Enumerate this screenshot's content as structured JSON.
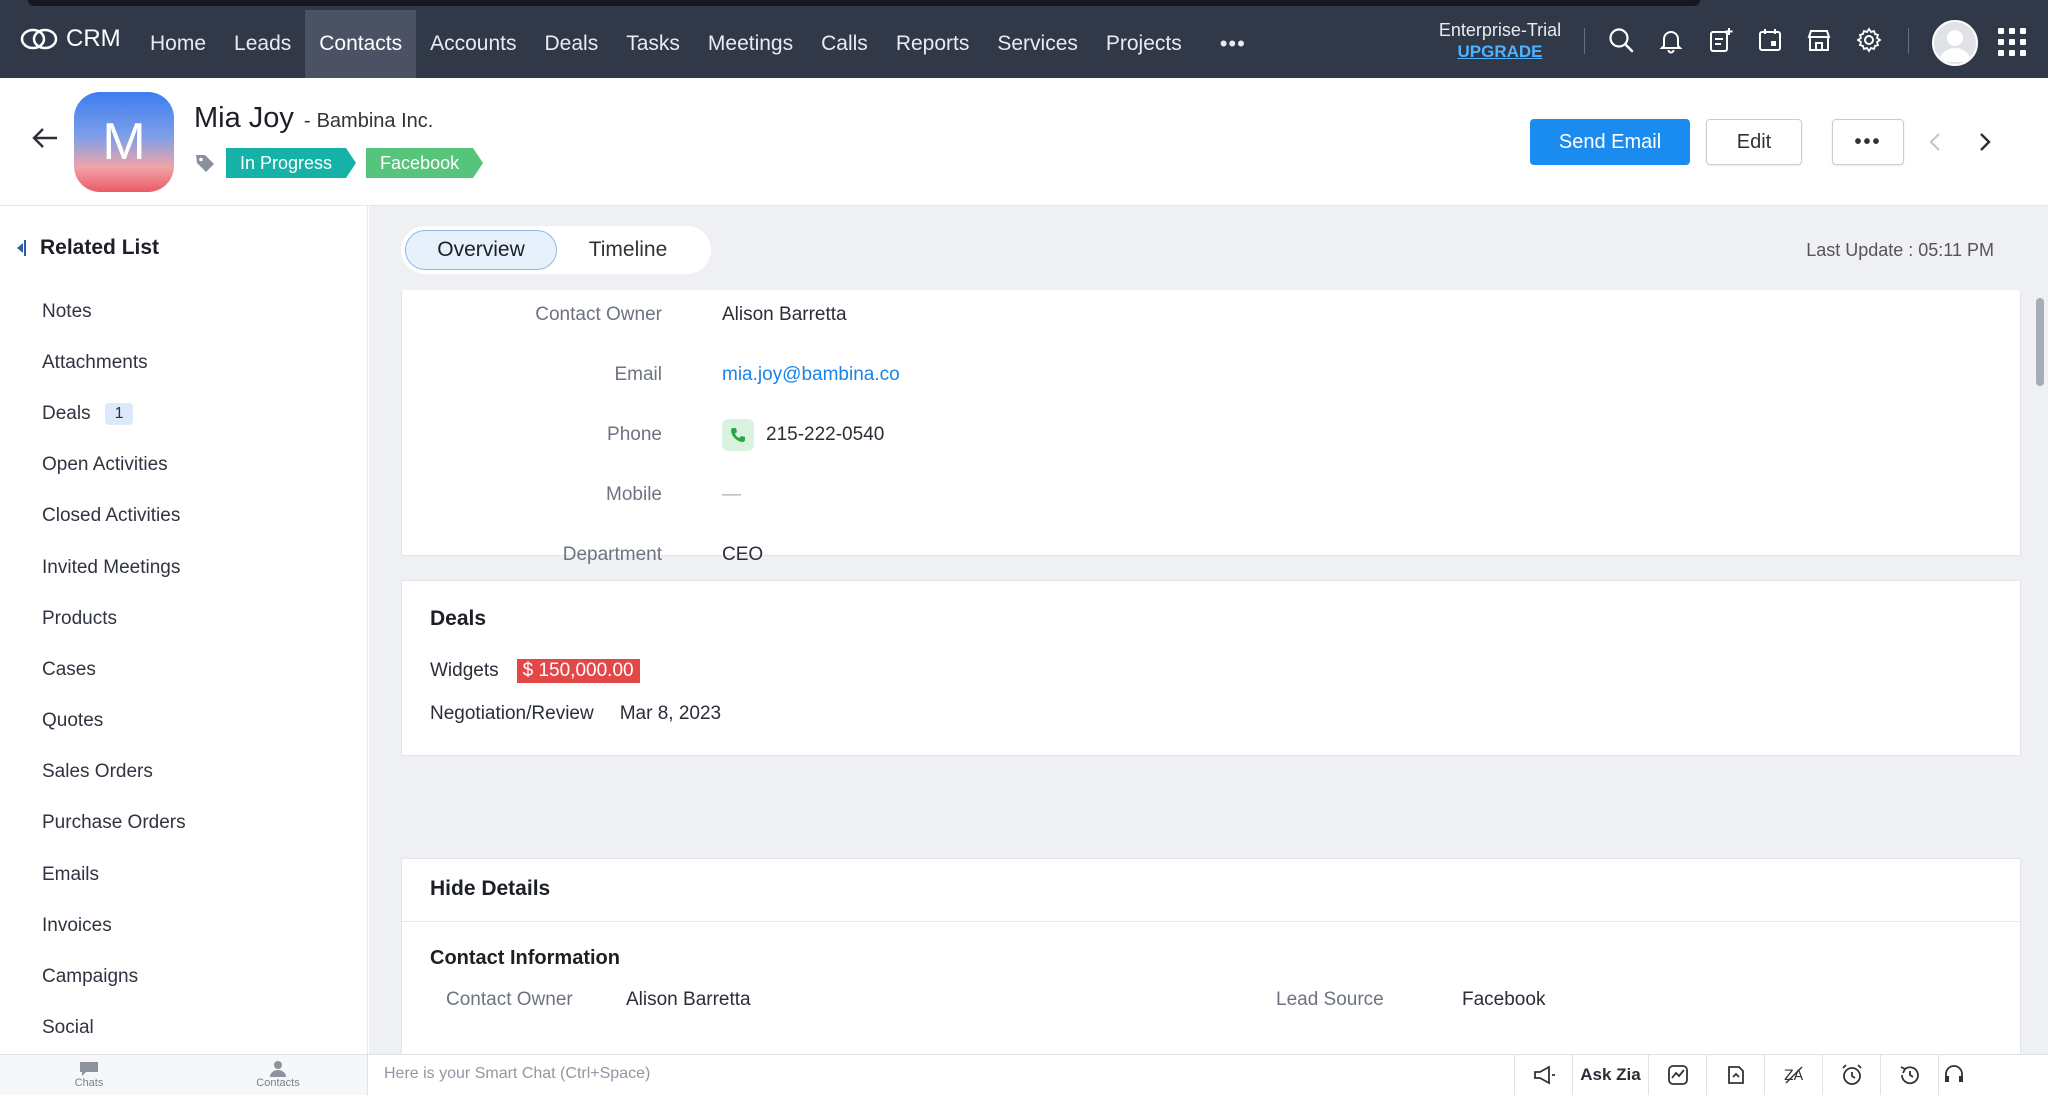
{
  "topnav": {
    "brand": "CRM",
    "items": [
      "Home",
      "Leads",
      "Contacts",
      "Accounts",
      "Deals",
      "Tasks",
      "Meetings",
      "Calls",
      "Reports",
      "Services",
      "Projects"
    ],
    "active": "Contacts",
    "more": "•••",
    "plan": "Enterprise-Trial",
    "upgrade": "UPGRADE",
    "icons": [
      "search-icon",
      "bell-icon",
      "add-note-icon",
      "calendar-icon",
      "marketplace-icon",
      "settings-icon",
      "user-avatar",
      "apps-grid-icon"
    ]
  },
  "record": {
    "initial": "M",
    "name": "Mia Joy",
    "company": "Bambina Inc.",
    "company_prefix": "-",
    "tags": [
      "In Progress",
      "Facebook"
    ],
    "send_email": "Send Email",
    "edit": "Edit",
    "more": "•••"
  },
  "sidebar": {
    "title": "Related List",
    "items": [
      {
        "label": "Notes",
        "count": ""
      },
      {
        "label": "Attachments",
        "count": ""
      },
      {
        "label": "Deals",
        "count": "1"
      },
      {
        "label": "Open Activities",
        "count": ""
      },
      {
        "label": "Closed Activities",
        "count": ""
      },
      {
        "label": "Invited Meetings",
        "count": ""
      },
      {
        "label": "Products",
        "count": ""
      },
      {
        "label": "Cases",
        "count": ""
      },
      {
        "label": "Quotes",
        "count": ""
      },
      {
        "label": "Sales Orders",
        "count": ""
      },
      {
        "label": "Purchase Orders",
        "count": ""
      },
      {
        "label": "Emails",
        "count": ""
      },
      {
        "label": "Invoices",
        "count": ""
      },
      {
        "label": "Campaigns",
        "count": ""
      },
      {
        "label": "Social",
        "count": ""
      }
    ]
  },
  "tabs": {
    "overview": "Overview",
    "timeline": "Timeline",
    "active": "Overview"
  },
  "last_update": "Last Update : 05:11 PM",
  "overview": {
    "fields": [
      {
        "label": "Contact Owner",
        "value": "Alison Barretta"
      },
      {
        "label": "Email",
        "value": "mia.joy@bambina.co"
      },
      {
        "label": "Phone",
        "value": "215-222-0540"
      },
      {
        "label": "Mobile",
        "value": "—"
      },
      {
        "label": "Department",
        "value": "CEO"
      }
    ]
  },
  "deals": {
    "title": "Deals",
    "name": "Widgets",
    "amount": "$ 150,000.00",
    "stage": "Negotiation/Review",
    "date": "Mar 8, 2023"
  },
  "details": {
    "hide": "Hide Details",
    "section": "Contact Information",
    "contact_owner_label": "Contact Owner",
    "contact_owner": "Alison Barretta",
    "lead_source_label": "Lead Source",
    "lead_source": "Facebook"
  },
  "bottombar": {
    "apps": [
      "Chats",
      "Contacts"
    ],
    "smartchat_placeholder": "Here is your Smart Chat (Ctrl+Space)",
    "ask_zia": "Ask Zia"
  },
  "colors": {
    "topbar": "#313949",
    "primary": "#1a8cf0",
    "tag_in_progress": "#16b2a7",
    "tag_facebook": "#57c47b",
    "deal_amount": "#e24848",
    "link": "#1a83e8"
  }
}
